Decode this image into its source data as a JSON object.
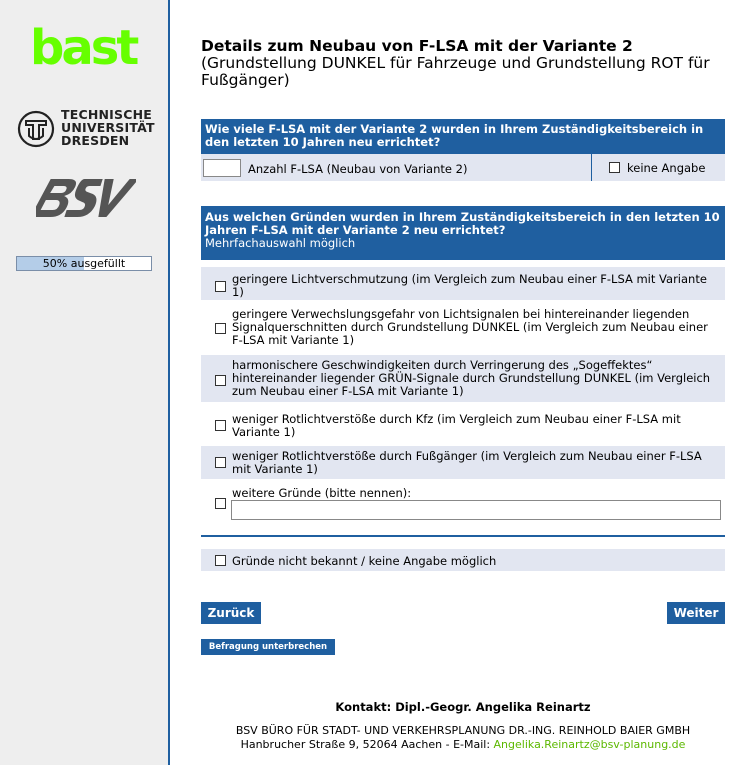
{
  "sidebar": {
    "logo_bast": "bast",
    "tu_logo": {
      "line1": "TECHNISCHE",
      "line2": "UNIVERSITÄT",
      "line3": "DRESDEN"
    },
    "bsv_logo": "BSV",
    "progress": {
      "label": "50% ausgefüllt",
      "fraction": 0.5,
      "fill_color": "#b4cde8"
    }
  },
  "title": {
    "line1": "Details zum Neubau von F-LSA mit der Variante 2",
    "line2": "(Grundstellung DUNKEL für Fahrzeuge und Grundstellung ROT für Fußgänger)"
  },
  "question1": {
    "header": "Wie viele F-LSA mit der Variante 2 wurden in Ihrem Zuständigkeitsbereich in den letzten 10 Jahren neu errichtet?",
    "count_label": "Anzahl F-LSA (Neubau von Variante 2)",
    "count_value": "",
    "no_answer_label": "keine Angabe"
  },
  "question2": {
    "header": "Aus welchen Gründen wurden in Ihrem Zuständigkeitsbereich in den letzten 10 Jahren F-LSA mit der Variante 2 neu errichtet?",
    "subheader": "Mehrfachauswahl möglich",
    "options": [
      {
        "label": "geringere Lichtverschmutzung (im Vergleich zum Neubau einer F-LSA mit Variante 1)"
      },
      {
        "label": "geringere Verwechslungsgefahr von Lichtsignalen bei hintereinander liegenden Signalquerschnitten durch Grundstellung DUNKEL (im Vergleich zum Neubau einer F-LSA mit Variante 1)"
      },
      {
        "label": "harmonischere Geschwindigkeiten durch Verringerung des „Sogeffektes“ hintereinander liegender GRÜN-Signale durch Grundstellung DUNKEL (im Vergleich zum Neubau einer F-LSA mit Variante 1)"
      },
      {
        "label": "weniger Rotlichtverstöße durch Kfz (im Vergleich zum Neubau einer F-LSA mit Variante 1)"
      },
      {
        "label": "weniger Rotlichtverstöße durch Fußgänger (im Vergleich zum Neubau einer F-LSA mit Variante 1)"
      },
      {
        "label": "weitere Gründe (bitte nennen):"
      }
    ],
    "other_value": "",
    "unknown_label": "Gründe nicht bekannt / keine Angabe möglich"
  },
  "buttons": {
    "back": "Zurück",
    "next": "Weiter",
    "pause": "Befragung unterbrechen"
  },
  "contact": {
    "title": "Kontakt: Dipl.-Geogr. Angelika Reinartz",
    "line1": "BSV BÜRO FÜR STADT- UND VERKEHRSPLANUNG DR.-ING. REINHOLD BAIER GMBH",
    "line2_prefix": "Hanbrucher Straße 9, 52064 Aachen - E-Mail: ",
    "email": "Angelika.Reinartz@bsv-planung.de"
  },
  "colors": {
    "accent": "#1f5fa0",
    "row_shade": "#e2e6f1",
    "bast_green": "#66ff00",
    "email_green": "#5cb800"
  }
}
